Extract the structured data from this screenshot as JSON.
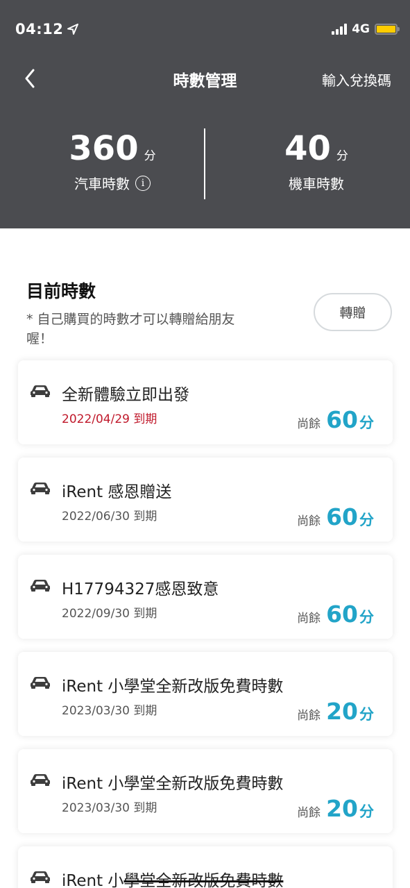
{
  "status": {
    "time": "04:12",
    "network": "4G",
    "colors": {
      "battery": "#ffcc00"
    }
  },
  "nav": {
    "title": "時數管理",
    "redeem_label": "輸入兌換碼"
  },
  "summary": {
    "car": {
      "value": "360",
      "unit": "分",
      "label": "汽車時數"
    },
    "motorcycle": {
      "value": "40",
      "unit": "分",
      "label": "機車時數"
    }
  },
  "current": {
    "title": "目前時數",
    "note": "* 自己購買的時數才可以轉贈給朋友喔！",
    "transfer_label": "轉贈"
  },
  "cards": [
    {
      "title": "全新體驗立即出發",
      "expiry": "2022/04/29 到期",
      "urgent": true,
      "remain_label": "尚餘",
      "remain_value": "60",
      "remain_unit": "分"
    },
    {
      "title": "iRent 感恩贈送",
      "expiry": "2022/06/30 到期",
      "urgent": false,
      "remain_label": "尚餘",
      "remain_value": "60",
      "remain_unit": "分"
    },
    {
      "title": "H17794327感恩致意",
      "expiry": "2022/09/30 到期",
      "urgent": false,
      "remain_label": "尚餘",
      "remain_value": "60",
      "remain_unit": "分"
    },
    {
      "title": "iRent 小學堂全新改版免費時數",
      "expiry": "2023/03/30 到期",
      "urgent": false,
      "remain_label": "尚餘",
      "remain_value": "20",
      "remain_unit": "分"
    },
    {
      "title": "iRent 小學堂全新改版免費時數",
      "expiry": "2023/03/30 到期",
      "urgent": false,
      "remain_label": "尚餘",
      "remain_value": "20",
      "remain_unit": "分"
    }
  ],
  "partial_card": {
    "title_prefix": "iRent 小",
    "title_struck": "學堂全新改版免費時數"
  },
  "colors": {
    "header_bg": "#4b4c50",
    "accent": "#22a4c8",
    "expiry_warning": "#c0192b"
  }
}
